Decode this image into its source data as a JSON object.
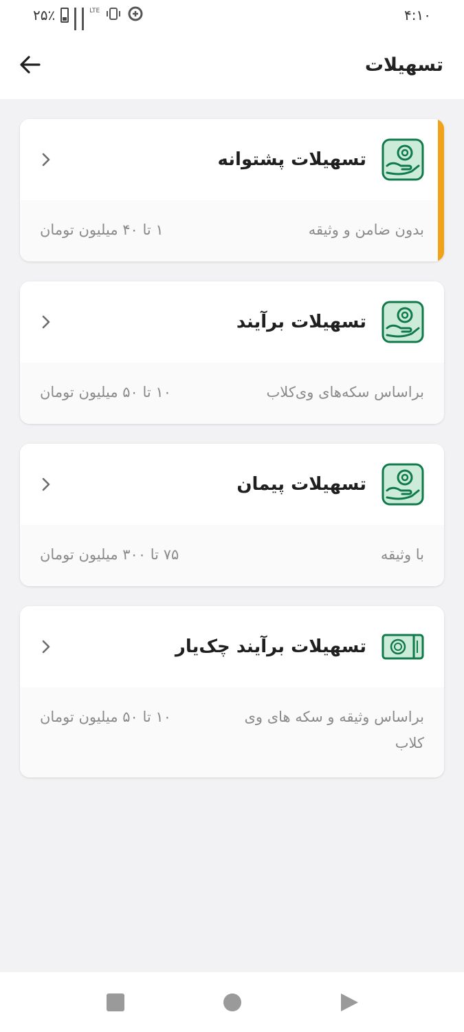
{
  "status": {
    "time": "۴:۱۰",
    "battery": "۲۵٪",
    "network": "LTE"
  },
  "header": {
    "title": "تسهیلات",
    "back_icon": "arrow-left-icon"
  },
  "colors": {
    "accent": "#f0a21b",
    "icon_green": "#0e7a4a",
    "icon_bg": "#cdebd9"
  },
  "cards": [
    {
      "title": "تسهیلات پشتوانه",
      "desc": "بدون ضامن و وثیقه",
      "range": "۱ تا ۴۰ میلیون تومان",
      "icon": "hand-coin-icon",
      "selected": true
    },
    {
      "title": "تسهیلات برآیند",
      "desc": "براساس سکه‌های وی‌کلاب",
      "range": "۱۰ تا ۵۰ میلیون تومان",
      "icon": "hand-coin-icon",
      "selected": false
    },
    {
      "title": "تسهیلات پیمان",
      "desc": "با وثیقه",
      "range": "۷۵ تا ۳۰۰ میلیون تومان",
      "icon": "hand-coin-icon",
      "selected": false
    },
    {
      "title": "تسهیلات برآیند چک‌یار",
      "desc": "براساس وثیقه و سکه های وی کلاب",
      "range": "۱۰ تا ۵۰ میلیون تومان",
      "icon": "cheque-icon",
      "selected": false
    }
  ],
  "navbar": {
    "items": [
      "recents-square-icon",
      "home-circle-icon",
      "back-triangle-icon"
    ]
  }
}
